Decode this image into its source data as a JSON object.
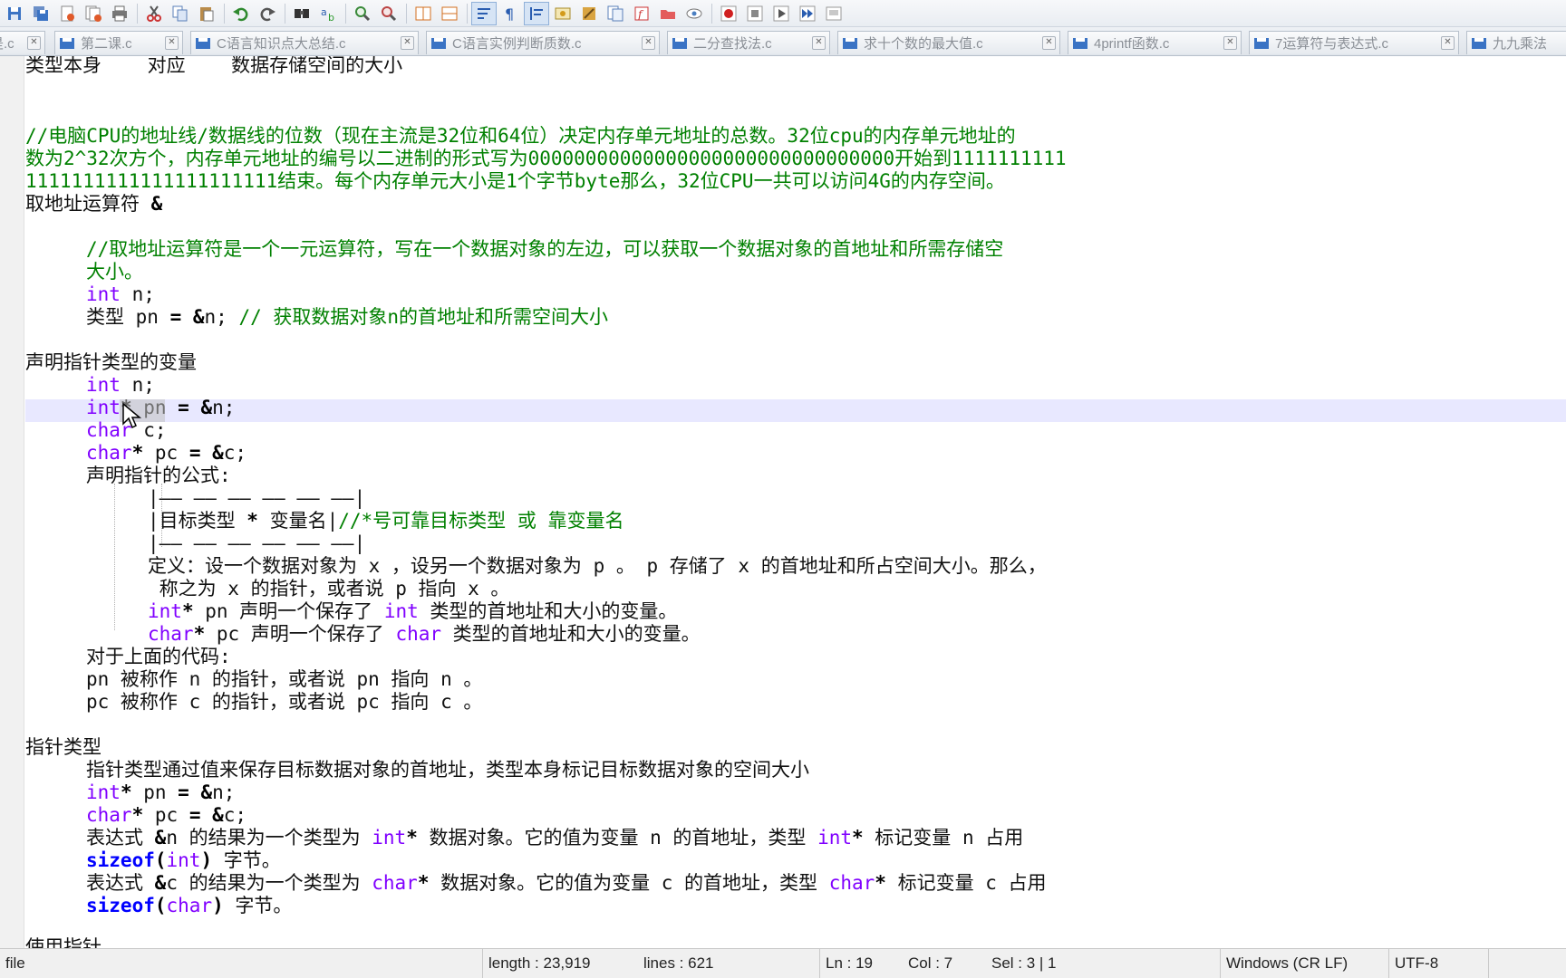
{
  "tabs": [
    {
      "label": "是.c"
    },
    {
      "label": "第二课.c"
    },
    {
      "label": "C语言知识点大总结.c"
    },
    {
      "label": "C语言实例判断质数.c"
    },
    {
      "label": "二分查找法.c"
    },
    {
      "label": "求十个数的最大值.c"
    },
    {
      "label": "4printf函数.c"
    },
    {
      "label": "7运算符与表达式.c"
    },
    {
      "label": "九九乘法"
    }
  ],
  "editor": {
    "l1": "类型本身    对应    数据存储空间的大小",
    "l2": "//电脑CPU的地址线/数据线的位数（现在主流是32位和64位）决定内存单元地址的总数。32位cpu的内存单元地址的",
    "l3": "数为2^32次方个，内存单元地址的编号以二进制的形式写为00000000000000000000000000000000开始到1111111111",
    "l4": "1111111111111111111111结束。每个内存单元大小是1个字节byte那么，32位CPU一共可以访问4G的内存空间。",
    "l5a": "取地址运算符 ",
    "l5b": "&",
    "l6": "//取地址运算符是一个一元运算符，写在一个数据对象的左边，可以获取一个数据对象的首地址和所需存储空",
    "l7": "大小。",
    "l8kw": "int",
    "l8": " n;",
    "l9a": "类型 pn ",
    "l9op1": "=",
    "l9op2": " &",
    "l9b": "n; ",
    "l9c": "// 获取数据对象n的首地址和所需空间大小",
    "l10": "声明指针类型的变量",
    "l11kw": "int",
    "l11": " n;",
    "l12kw": "int",
    "l12op": "*",
    "l12": " pn ",
    "l12op2": "= &",
    "l12b": "n;",
    "l13kw": "char",
    "l13": " c;",
    "l14kw": "char",
    "l14op": "*",
    "l14": " pc ",
    "l14op2": "= &",
    "l14b": "c;",
    "l15": "声明指针的公式:",
    "l16": "|—— —— —— —— —— ——|",
    "l17a": "|目标类型 ",
    "l17op": "*",
    "l17b": " 变量名|",
    "l17c": "//*号可靠目标类型 或 靠变量名",
    "l18": "|—— —— —— —— —— ——|",
    "l19": "定义：设一个数据对象为 x ，设另一个数据对象为 p 。 p 存储了 x 的首地址和所占空间大小。那么，",
    "l20": " 称之为 x 的指针，或者说 p 指向 x 。",
    "l21kw": "int",
    "l21op": "*",
    "l21a": " pn 声明一个保存了 ",
    "l21kw2": "int",
    "l21b": " 类型的首地址和大小的变量。",
    "l22kw": "char",
    "l22op": "*",
    "l22a": " pc 声明一个保存了 ",
    "l22kw2": "char",
    "l22b": " 类型的首地址和大小的变量。",
    "l23": "对于上面的代码:",
    "l24": "pn 被称作 n 的指针，或者说 pn 指向 n 。",
    "l25": "pc 被称作 c 的指针，或者说 pc 指向 c 。",
    "l26": "指针类型",
    "l27": "指针类型通过值来保存目标数据对象的首地址，类型本身标记目标数据对象的空间大小",
    "l28kw": "int",
    "l28op": "*",
    "l28": " pn ",
    "l28op2": "= &",
    "l28b": "n;",
    "l29kw": "char",
    "l29op": "*",
    "l29": " pc ",
    "l29op2": "= &",
    "l29b": "c;",
    "l30a": "表达式 ",
    "l30op": "&",
    "l30b": "n 的结果为一个类型为 ",
    "l30kw": "int",
    "l30op2": "*",
    "l30c": " 数据对象。它的值为变量 n 的首地址，类型 ",
    "l30kw2": "int",
    "l30op3": "*",
    "l30d": " 标记变量 n 占用",
    "l31kw": "sizeof",
    "l31op": "(",
    "l31kw2": "int",
    "l31op2": ")",
    "l31": " 字节。",
    "l32a": "表达式 ",
    "l32op": "&",
    "l32b": "c 的结果为一个类型为 ",
    "l32kw": "char",
    "l32op2": "*",
    "l32c": " 数据对象。它的值为变量 c 的首地址，类型 ",
    "l32kw2": "char",
    "l32op3": "*",
    "l32d": " 标记变量 c 占用",
    "l33kw": "sizeof",
    "l33op": "(",
    "l33kw2": "char",
    "l33op2": ")",
    "l33": " 字节。",
    "l34": "使用指针"
  },
  "status": {
    "file": "file",
    "length": "length : 23,919",
    "lines": "lines : 621",
    "ln": "Ln : 19",
    "col": "Col : 7",
    "sel": "Sel : 3 | 1",
    "eol": "Windows (CR LF)",
    "enc": "UTF-8"
  },
  "colors": {
    "comment": "#008000",
    "keyword": "#8000ff",
    "keyword_bold": "#0000ff",
    "current_line": "#e8e8ff"
  }
}
